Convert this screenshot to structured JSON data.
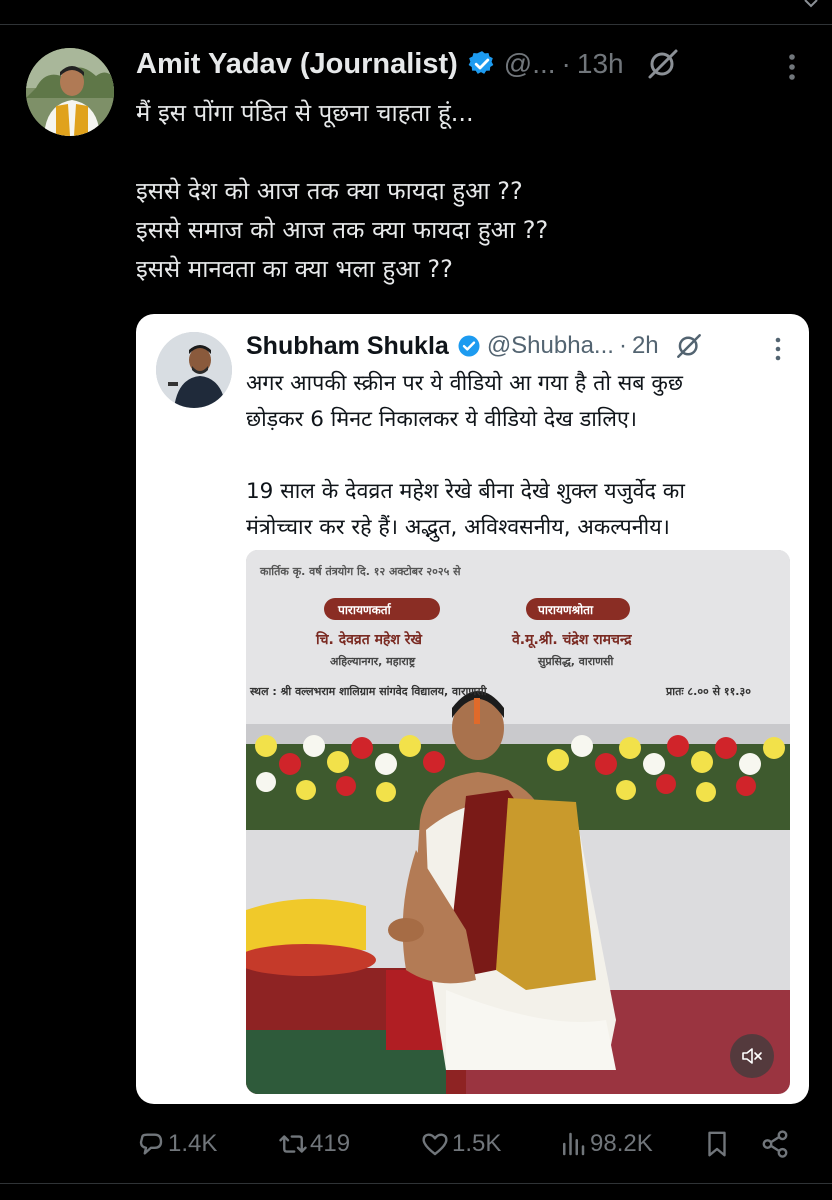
{
  "tweet": {
    "author_name": "Amit Yadav (Journalist)",
    "handle": "@...",
    "separator": "·",
    "time": "13h",
    "text_lines": [
      "मैं इस पोंगा पंडित से पूछना चाहता हूं...",
      "",
      "इससे देश को आज तक क्या फायदा हुआ ??",
      "इससे समाज को आज तक क्या फायदा हुआ ??",
      "इससे मानवता का क्या भला हुआ ??"
    ]
  },
  "quoted_tweet": {
    "author_name": "Shubham Shukla",
    "handle": "@Shubha...",
    "separator": "·",
    "time": "2h",
    "text_lines": [
      "अगर आपकी स्क्रीन पर ये वीडियो आ गया है तो सब कुछ",
      "छोड़कर 6 मिनट निकालकर ये वीडियो देख डालिए।",
      "",
      "19 साल के देवव्रत महेश रेखे बीना देखे शुक्ल यजुर्वेद का",
      "मंत्रोच्चार कर रहे हैं। अद्भुत, अविश्वसनीय, अकल्पनीय।"
    ],
    "video": {
      "banner_line_1": "कार्तिक कृ. वर्ष तंत्रयोग दि. १२ अक्टोबर २०२५ से",
      "banner_left_label": "पारायणकर्ता",
      "banner_left_name": "चि. देवव्रत महेश रेखे",
      "banner_left_sub": "अहिल्यानगर, महाराष्ट्र",
      "banner_right_label": "पारायणश्रोता",
      "banner_right_name": "वे.मू.श्री. चंद्रेश रामचन्द्र",
      "banner_right_sub": "सुप्रसिद्ध, वाराणसी",
      "banner_venue": "स्थल : श्री वल्लभराम शालिग्राम सांगवेद विद्यालय, वाराणसी",
      "banner_time": "प्रातः ८.०० से ११.३०",
      "muted": true
    }
  },
  "actions": {
    "replies": "1.4K",
    "reposts": "419",
    "likes": "1.5K",
    "views": "98.2K"
  },
  "colors": {
    "background": "#000000",
    "text_primary": "#e7e9ea",
    "text_secondary": "#71767b",
    "verified": "#1d9bf0",
    "card_background": "#ffffff"
  },
  "icons": {
    "verified": "verified-badge-icon",
    "grok": "grok-icon",
    "more": "more-vertical-icon",
    "reply": "reply-bubble-icon",
    "repost": "repost-icon",
    "like": "heart-icon",
    "views": "bar-chart-icon",
    "bookmark": "bookmark-icon",
    "share": "share-icon",
    "mute": "speaker-muted-icon"
  }
}
